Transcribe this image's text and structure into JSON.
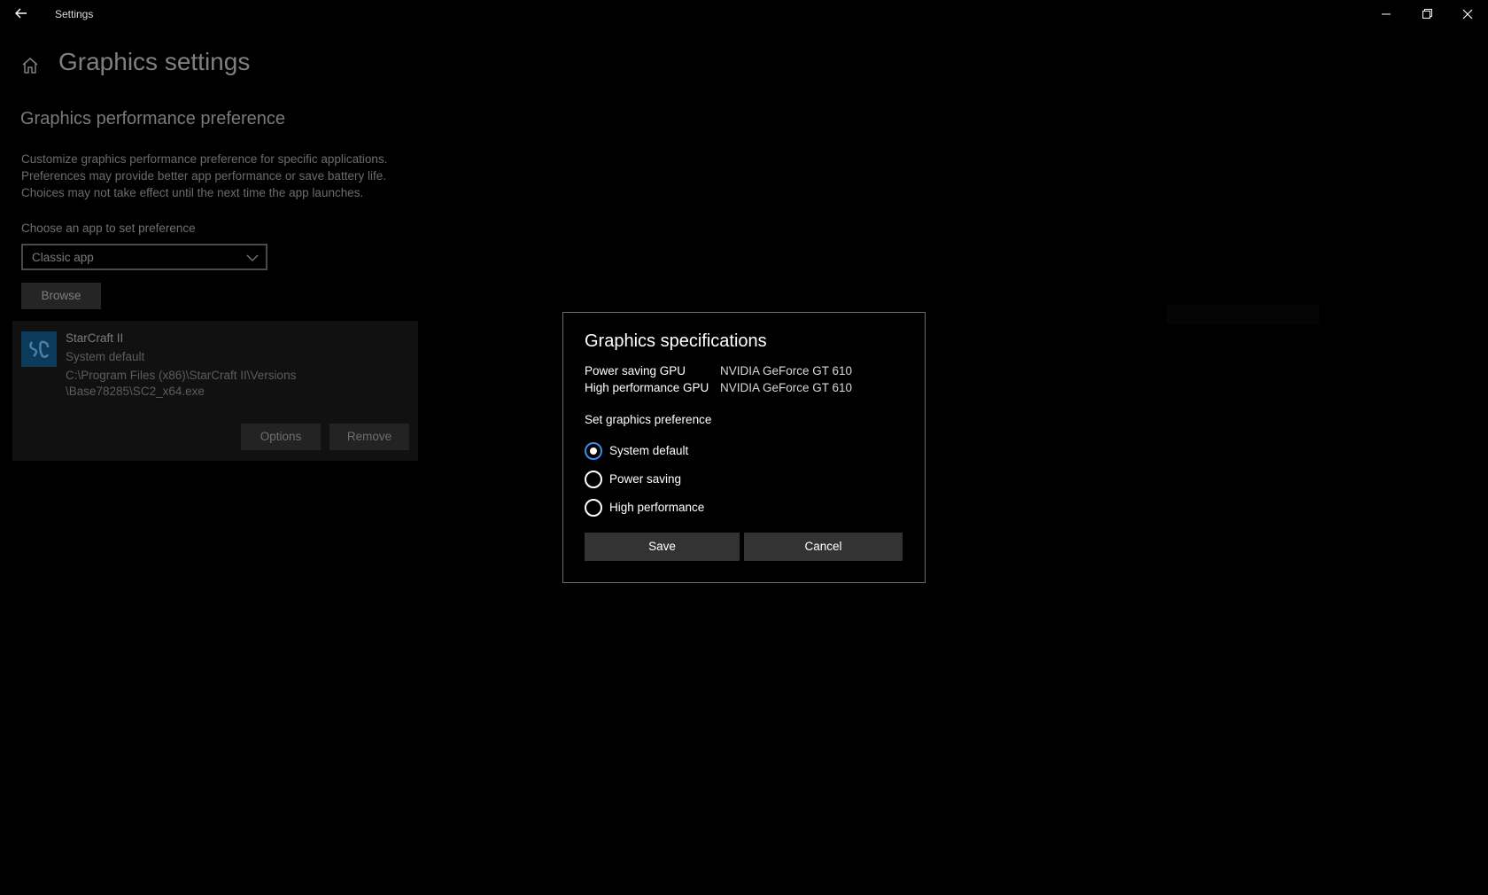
{
  "titlebar": {
    "title": "Settings",
    "back_icon": "back-arrow-icon",
    "minimize_icon": "minimize-icon",
    "restore_icon": "restore-icon",
    "close_icon": "close-icon"
  },
  "page": {
    "home_icon": "home-icon",
    "title": "Graphics settings",
    "section_title": "Graphics performance preference",
    "description_lines": [
      "Customize graphics performance preference for specific applications.",
      "Preferences may provide better app performance or save battery life.",
      "Choices may not take effect until the next time the app launches."
    ],
    "choose_label": "Choose an app to set preference",
    "app_type_selected": "Classic app",
    "browse_label": "Browse",
    "app_card": {
      "name": "StarCraft II",
      "preference": "System default",
      "path_lines": [
        "C:\\Program Files (x86)\\StarCraft II\\Versions",
        "\\Base78285\\SC2_x64.exe"
      ],
      "options_label": "Options",
      "remove_label": "Remove"
    }
  },
  "dialog": {
    "title": "Graphics specifications",
    "specs": [
      {
        "label": "Power saving GPU",
        "value": "NVIDIA GeForce GT 610"
      },
      {
        "label": "High performance GPU",
        "value": "NVIDIA GeForce GT 610"
      }
    ],
    "pref_label": "Set graphics preference",
    "options": [
      {
        "label": "System default",
        "checked": true
      },
      {
        "label": "Power saving",
        "checked": false
      },
      {
        "label": "High performance",
        "checked": false
      }
    ],
    "save_label": "Save",
    "cancel_label": "Cancel"
  },
  "colors": {
    "background": "#000000",
    "accent": "#3b8ee8",
    "button": "#333333",
    "dialog_border": "#6d6d6d"
  }
}
